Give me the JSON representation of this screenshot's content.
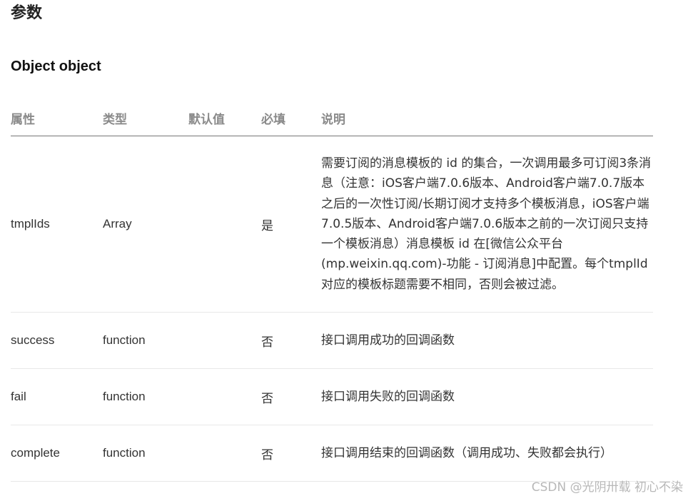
{
  "page": {
    "title": "参数",
    "section_title": "Object object"
  },
  "table": {
    "headers": [
      "属性",
      "类型",
      "默认值",
      "必填",
      "说明"
    ],
    "rows": [
      {
        "name": "tmplIds",
        "type": "Array",
        "default": "",
        "required": "是",
        "description": "需要订阅的消息模板的 id 的集合，一次调用最多可订阅3条消息（注意：iOS客户端7.0.6版本、Android客户端7.0.7版本之后的一次性订阅/长期订阅才支持多个模板消息，iOS客户端7.0.5版本、Android客户端7.0.6版本之前的一次订阅只支持一个模板消息）消息模板 id 在[微信公众平台(mp.weixin.qq.com)-功能 - 订阅消息]中配置。每个tmplId 对应的模板标题需要不相同，否则会被过滤。"
      },
      {
        "name": "success",
        "type": "function",
        "default": "",
        "required": "否",
        "description": "接口调用成功的回调函数"
      },
      {
        "name": "fail",
        "type": "function",
        "default": "",
        "required": "否",
        "description": "接口调用失败的回调函数"
      },
      {
        "name": "complete",
        "type": "function",
        "default": "",
        "required": "否",
        "description": "接口调用结束的回调函数（调用成功、失败都会执行）"
      }
    ]
  },
  "watermark": "CSDN @光阴卅载 初心不染"
}
